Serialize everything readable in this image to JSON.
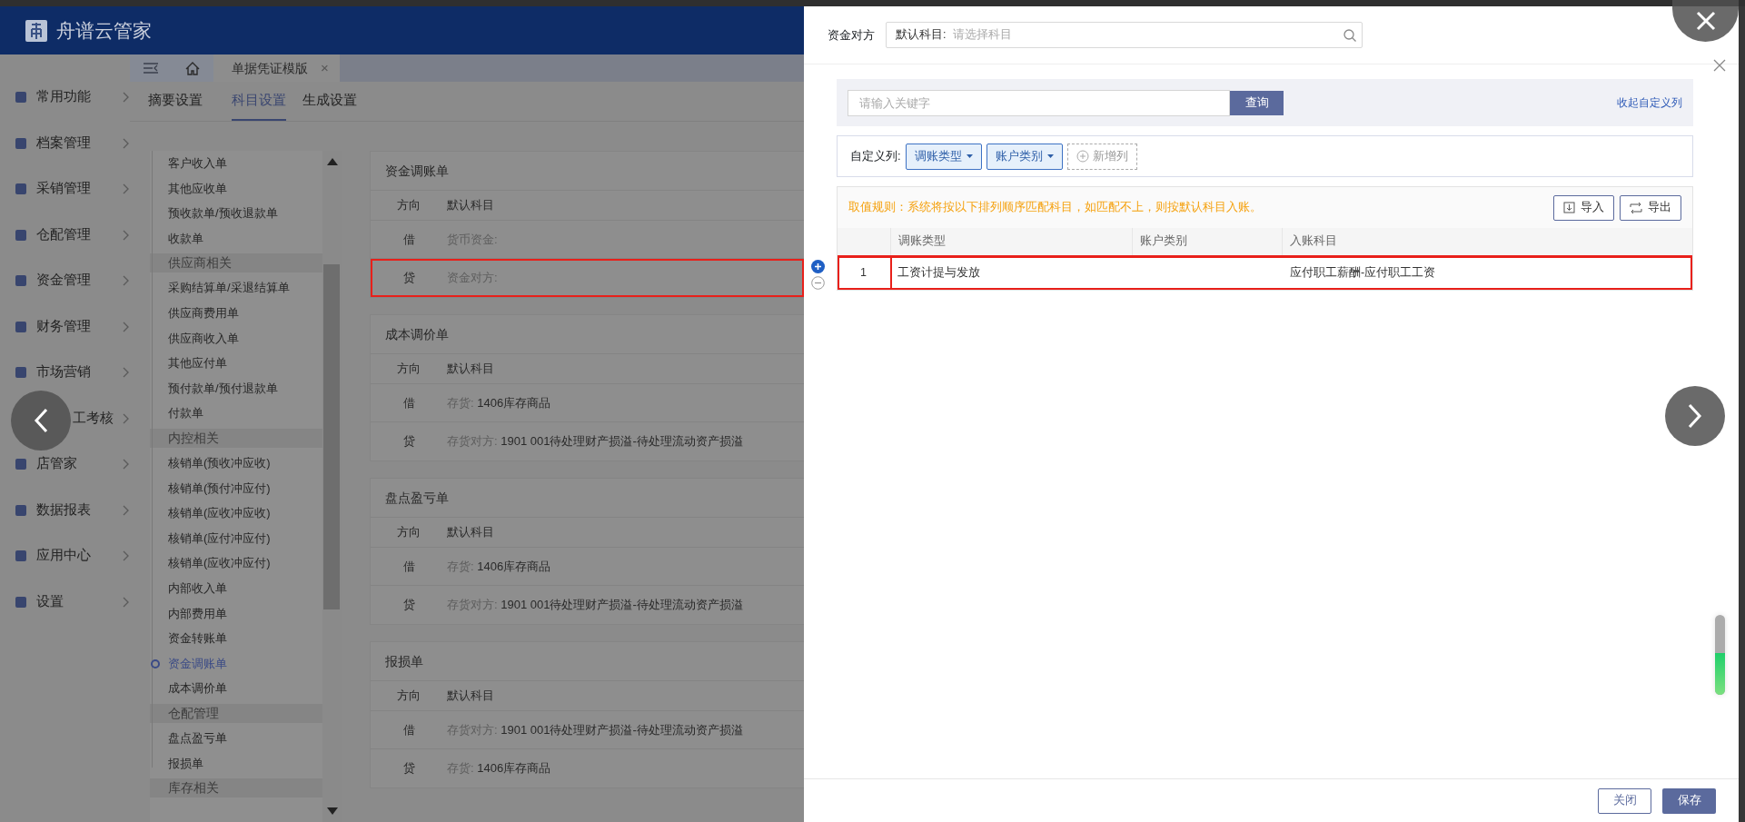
{
  "app": {
    "title": "舟谱云管家"
  },
  "sidebar": {
    "items": [
      {
        "label": "常用功能",
        "covered": false
      },
      {
        "label": "档案管理",
        "covered": false
      },
      {
        "label": "采销管理",
        "covered": false
      },
      {
        "label": "仓配管理",
        "covered": false
      },
      {
        "label": "资金管理",
        "covered": false
      },
      {
        "label": "财务管理",
        "covered": false
      },
      {
        "label": "市场营销",
        "covered": false
      },
      {
        "label": "工考核",
        "covered": true
      },
      {
        "label": "店管家",
        "covered": false
      },
      {
        "label": "数据报表",
        "covered": false
      },
      {
        "label": "应用中心",
        "covered": false
      },
      {
        "label": "设置",
        "covered": false
      }
    ]
  },
  "page_tabs": [
    {
      "label": "单据凭证模版",
      "selected": true,
      "close": "×"
    }
  ],
  "sub_tabs": [
    {
      "label": "摘要设置",
      "selected": false
    },
    {
      "label": "科目设置",
      "selected": true
    },
    {
      "label": "生成设置",
      "selected": false
    }
  ],
  "doc_list": [
    {
      "kind": "item",
      "label": "客户收入单",
      "selected": false
    },
    {
      "kind": "item",
      "label": "其他应收单",
      "selected": false
    },
    {
      "kind": "item",
      "label": "预收款单/预收退款单",
      "selected": false
    },
    {
      "kind": "item",
      "label": "收款单",
      "selected": false
    },
    {
      "kind": "group",
      "label": "供应商相关"
    },
    {
      "kind": "item",
      "label": "采购结算单/采退结算单",
      "selected": false
    },
    {
      "kind": "item",
      "label": "供应商费用单",
      "selected": false
    },
    {
      "kind": "item",
      "label": "供应商收入单",
      "selected": false
    },
    {
      "kind": "item",
      "label": "其他应付单",
      "selected": false
    },
    {
      "kind": "item",
      "label": "预付款单/预付退款单",
      "selected": false
    },
    {
      "kind": "item",
      "label": "付款单",
      "selected": false
    },
    {
      "kind": "group",
      "label": "内控相关"
    },
    {
      "kind": "item",
      "label": "核销单(预收冲应收)",
      "selected": false
    },
    {
      "kind": "item",
      "label": "核销单(预付冲应付)",
      "selected": false
    },
    {
      "kind": "item",
      "label": "核销单(应收冲应收)",
      "selected": false
    },
    {
      "kind": "item",
      "label": "核销单(应付冲应付)",
      "selected": false
    },
    {
      "kind": "item",
      "label": "核销单(应收冲应付)",
      "selected": false
    },
    {
      "kind": "item",
      "label": "内部收入单",
      "selected": false
    },
    {
      "kind": "item",
      "label": "内部费用单",
      "selected": false
    },
    {
      "kind": "item",
      "label": "资金转账单",
      "selected": false
    },
    {
      "kind": "item",
      "label": "资金调账单",
      "selected": true
    },
    {
      "kind": "item",
      "label": "成本调价单",
      "selected": false
    },
    {
      "kind": "group",
      "label": "仓配管理"
    },
    {
      "kind": "item",
      "label": "盘点盈亏单",
      "selected": false
    },
    {
      "kind": "item",
      "label": "报损单",
      "selected": false
    },
    {
      "kind": "group",
      "label": "库存相关"
    }
  ],
  "cards": [
    {
      "title": "资金调账单",
      "columns": [
        "方向",
        "默认科目"
      ],
      "rows": [
        {
          "direction": "借",
          "label": "货币资金:",
          "highlighted": false
        },
        {
          "direction": "贷",
          "label": "资金对方:",
          "highlighted": true
        }
      ]
    },
    {
      "title": "成本调价单",
      "columns": [
        "方向",
        "默认科目"
      ],
      "rows": [
        {
          "direction": "借",
          "label": "存货:",
          "value": "1406库存商品",
          "highlighted": false
        },
        {
          "direction": "贷",
          "label": "存货对方:",
          "value": "1901 001待处理财产损溢-待处理流动资产损溢",
          "highlighted": false
        }
      ]
    },
    {
      "title": "盘点盈亏单",
      "columns": [
        "方向",
        "默认科目"
      ],
      "rows": [
        {
          "direction": "借",
          "label": "存货:",
          "value": "1406库存商品",
          "highlighted": false
        },
        {
          "direction": "贷",
          "label": "存货对方:",
          "value": "1901 001待处理财产损溢-待处理流动资产损溢",
          "highlighted": false
        }
      ]
    },
    {
      "title": "报损单",
      "columns": [
        "方向",
        "默认科目"
      ],
      "rows": [
        {
          "direction": "借",
          "label": "存货对方:",
          "value": "1901 001待处理财产损溢-待处理流动资产损溢",
          "highlighted": false
        },
        {
          "direction": "贷",
          "label": "存货:",
          "value": "1406库存商品",
          "highlighted": false
        }
      ]
    }
  ],
  "dialog": {
    "field_label": "资金对方",
    "field_prefix": "默认科目:",
    "field_placeholder": "请选择科目",
    "search_placeholder": "请输入关键字",
    "search_button": "查询",
    "collapse_link": "收起自定义列",
    "custom_label": "自定义列:",
    "custom_columns": [
      {
        "label": "调账类型"
      },
      {
        "label": "账户类别"
      }
    ],
    "add_column": "新增列",
    "rule_text": "取值规则：系统将按以下排列顺序匹配科目，如匹配不上，则按默认科目入账。",
    "import_button": "导入",
    "export_button": "导出",
    "table": {
      "columns": [
        "调账类型",
        "账户类别",
        "入账科目"
      ],
      "rows": [
        {
          "index": "1",
          "cells": [
            "工资计提与发放",
            "",
            "应付职工薪酬-应付职工工资"
          ],
          "highlighted": true
        }
      ]
    },
    "close_button": "关闭",
    "save_button": "保存"
  },
  "meter": {
    "level": 0.52
  }
}
